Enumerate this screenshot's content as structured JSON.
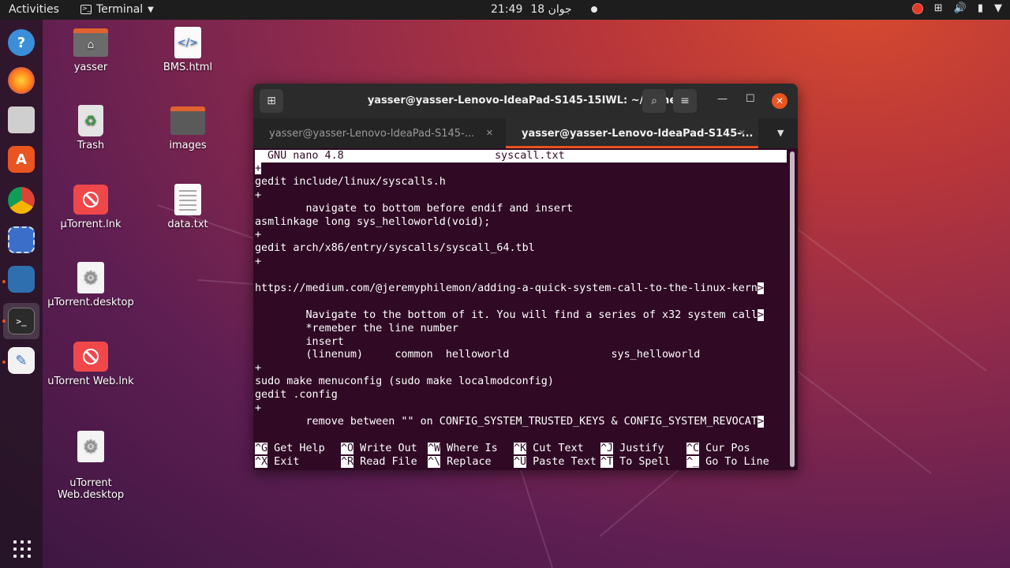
{
  "topbar": {
    "activities": "Activities",
    "app_name": "Terminal",
    "clock_time": "21:49",
    "clock_date": "18 جوان"
  },
  "desktop": {
    "icons": [
      {
        "label": "yasser"
      },
      {
        "label": "BMS.html"
      },
      {
        "label": "Trash"
      },
      {
        "label": "images"
      },
      {
        "label": "µTorrent.lnk"
      },
      {
        "label": "data.txt"
      },
      {
        "label": "µTorrent.desktop"
      },
      {
        "label": "uTorrent Web.lnk"
      },
      {
        "label": "uTorrent\nWeb.desktop"
      }
    ]
  },
  "terminal": {
    "title": "yasser@yasser-Lenovo-IdeaPad-S145-15IWL: ~/Tache3",
    "tabs": [
      {
        "label": "yasser@yasser-Lenovo-IdeaPad-S145-..."
      },
      {
        "label": "yasser@yasser-Lenovo-IdeaPad-S145-..."
      }
    ],
    "nano_version": "GNU nano 4.8",
    "filename": "syscall.txt",
    "lines": [
      "+",
      "gedit include/linux/syscalls.h",
      "+",
      "        navigate to bottom before endif and insert",
      "asmlinkage long sys_helloworld(void);",
      "+",
      "gedit arch/x86/entry/syscalls/syscall_64.tbl",
      "+",
      "",
      "https://medium.com/@jeremyphilemon/adding-a-quick-system-call-to-the-linux-kern",
      "",
      "        Navigate to the bottom of it. You will find a series of x32 system call",
      "        *remeber the line number",
      "        insert",
      "        (linenum)     common  helloworld                sys_helloworld",
      "+",
      "sudo make menuconfig (sudo make localmodconfig)",
      "gedit .config",
      "+",
      "        remove between \"\" on CONFIG_SYSTEM_TRUSTED_KEYS & CONFIG_SYSTEM_REVOCAT",
      ""
    ],
    "truncate_marker": ">",
    "shortcuts_row1": [
      {
        "key": "^G",
        "label": "Get Help"
      },
      {
        "key": "^O",
        "label": "Write Out"
      },
      {
        "key": "^W",
        "label": "Where Is"
      },
      {
        "key": "^K",
        "label": "Cut Text"
      },
      {
        "key": "^J",
        "label": "Justify"
      },
      {
        "key": "^C",
        "label": "Cur Pos"
      }
    ],
    "shortcuts_row2": [
      {
        "key": "^X",
        "label": "Exit"
      },
      {
        "key": "^R",
        "label": "Read File"
      },
      {
        "key": "^\\",
        "label": "Replace"
      },
      {
        "key": "^U",
        "label": "Paste Text"
      },
      {
        "key": "^T",
        "label": "To Spell"
      },
      {
        "key": "^_",
        "label": "Go To Line"
      }
    ]
  }
}
